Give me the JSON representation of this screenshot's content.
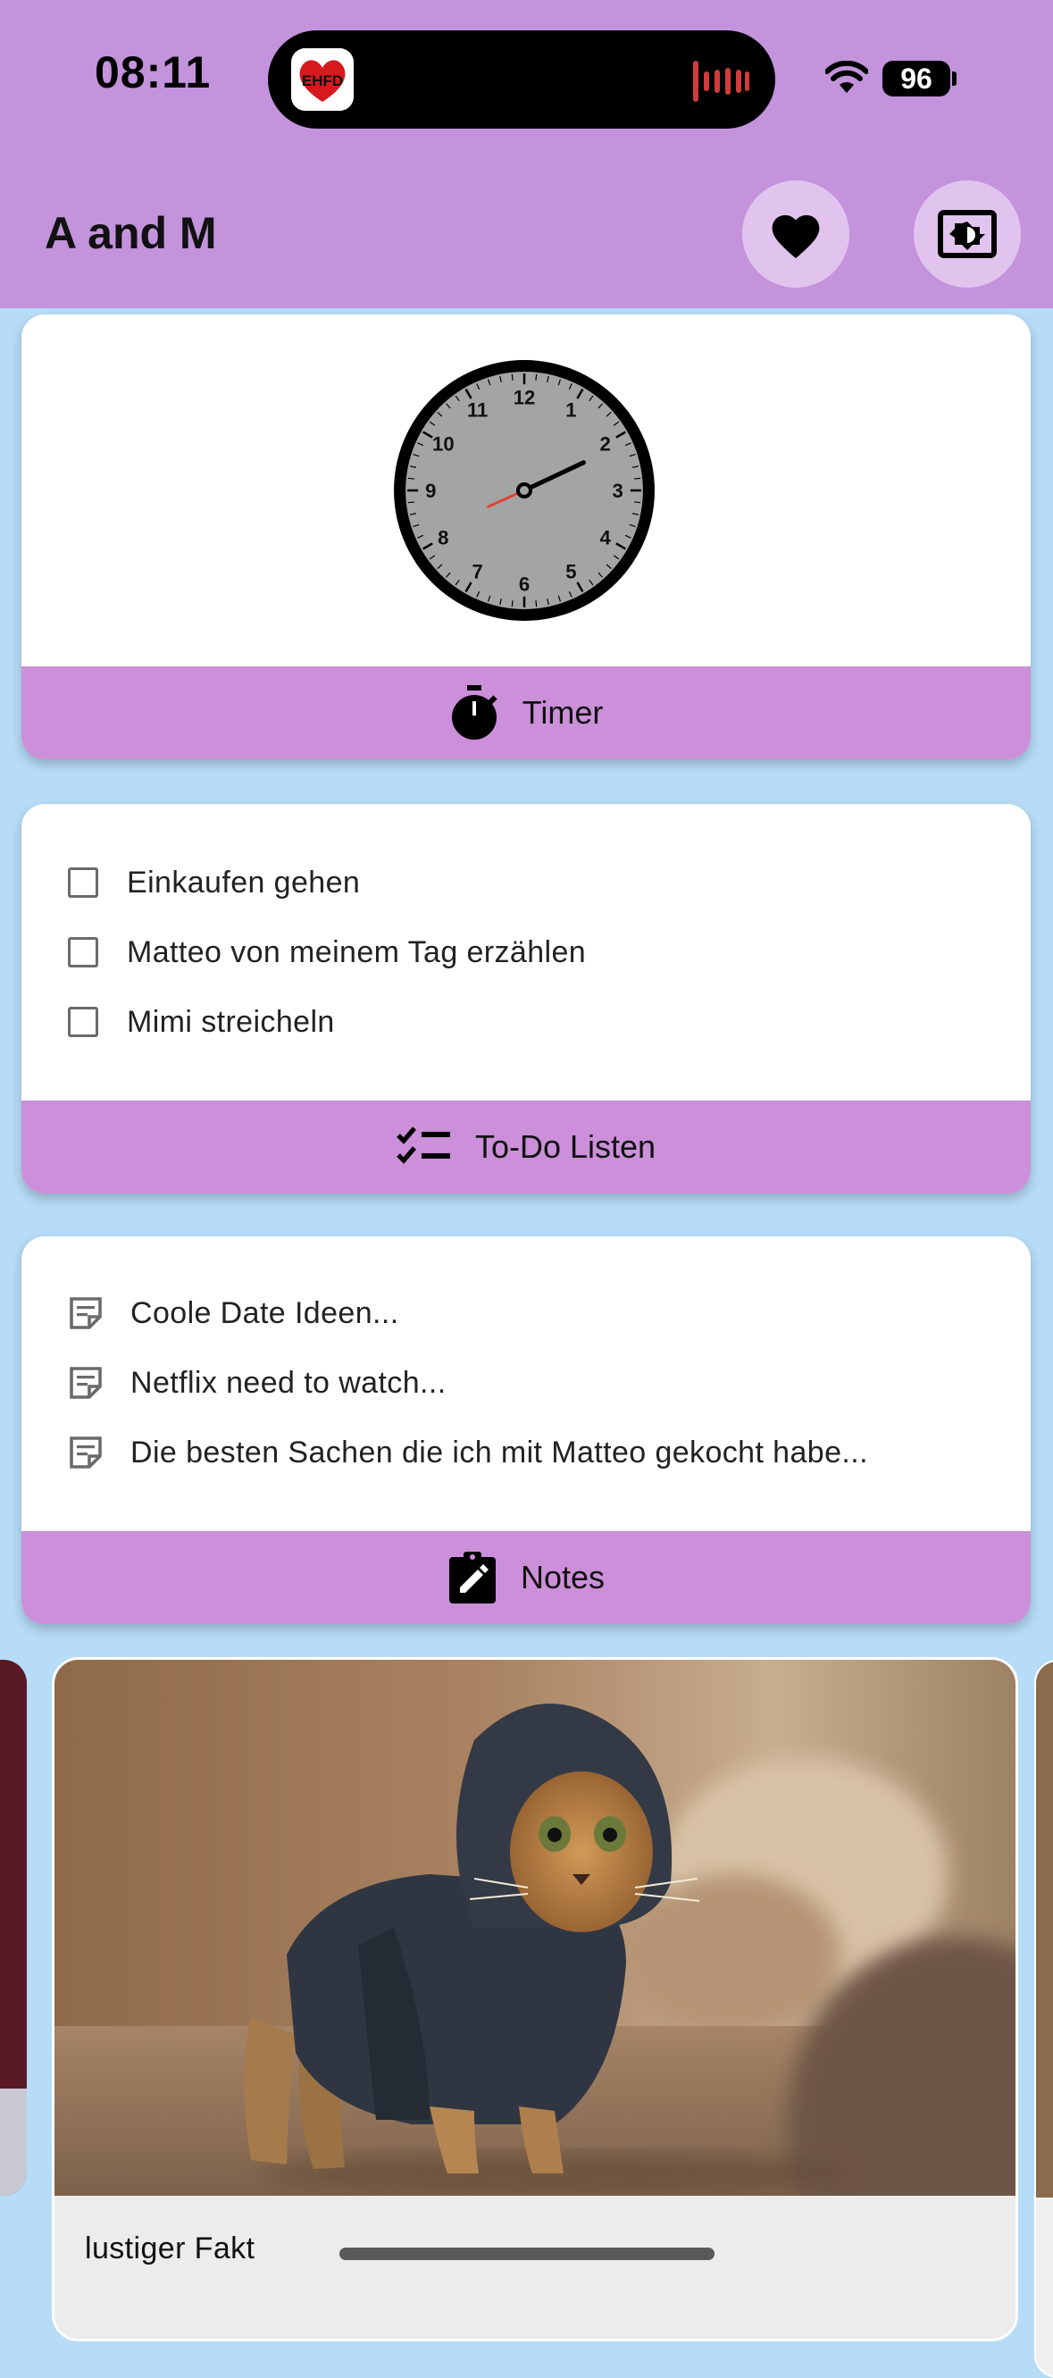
{
  "status_bar": {
    "time": "08:11",
    "island_app_label": "EHFD",
    "battery": "96"
  },
  "app_bar": {
    "title": "A and M",
    "colors": {
      "background": "#c393dc",
      "button_bg": "#e1c4ee"
    }
  },
  "clock_card": {
    "numbers": [
      "12",
      "1",
      "2",
      "3",
      "4",
      "5",
      "6",
      "7",
      "8",
      "9",
      "10",
      "11"
    ],
    "footer_label": "Timer",
    "footer_icon": "stopwatch-icon"
  },
  "todo_card": {
    "items": [
      {
        "label": "Einkaufen gehen",
        "checked": false
      },
      {
        "label": "Matteo von meinem Tag erzählen",
        "checked": false
      },
      {
        "label": "Mimi streicheln",
        "checked": false
      }
    ],
    "footer_label": "To-Do Listen",
    "footer_icon": "checklist-icon"
  },
  "notes_card": {
    "items": [
      {
        "label": "Coole Date Ideen..."
      },
      {
        "label": "Netflix need to watch..."
      },
      {
        "label": "Die besten Sachen die ich mit Matteo gekocht habe..."
      }
    ],
    "footer_label": "Notes",
    "footer_icon": "assignment-edit-icon"
  },
  "carousel": {
    "current": {
      "caption": "lustiger Fakt",
      "image": "cat-in-hoodie-photo"
    }
  },
  "colors": {
    "page_background": "#b7dcf7",
    "card_footer": "#cc8fd9"
  }
}
